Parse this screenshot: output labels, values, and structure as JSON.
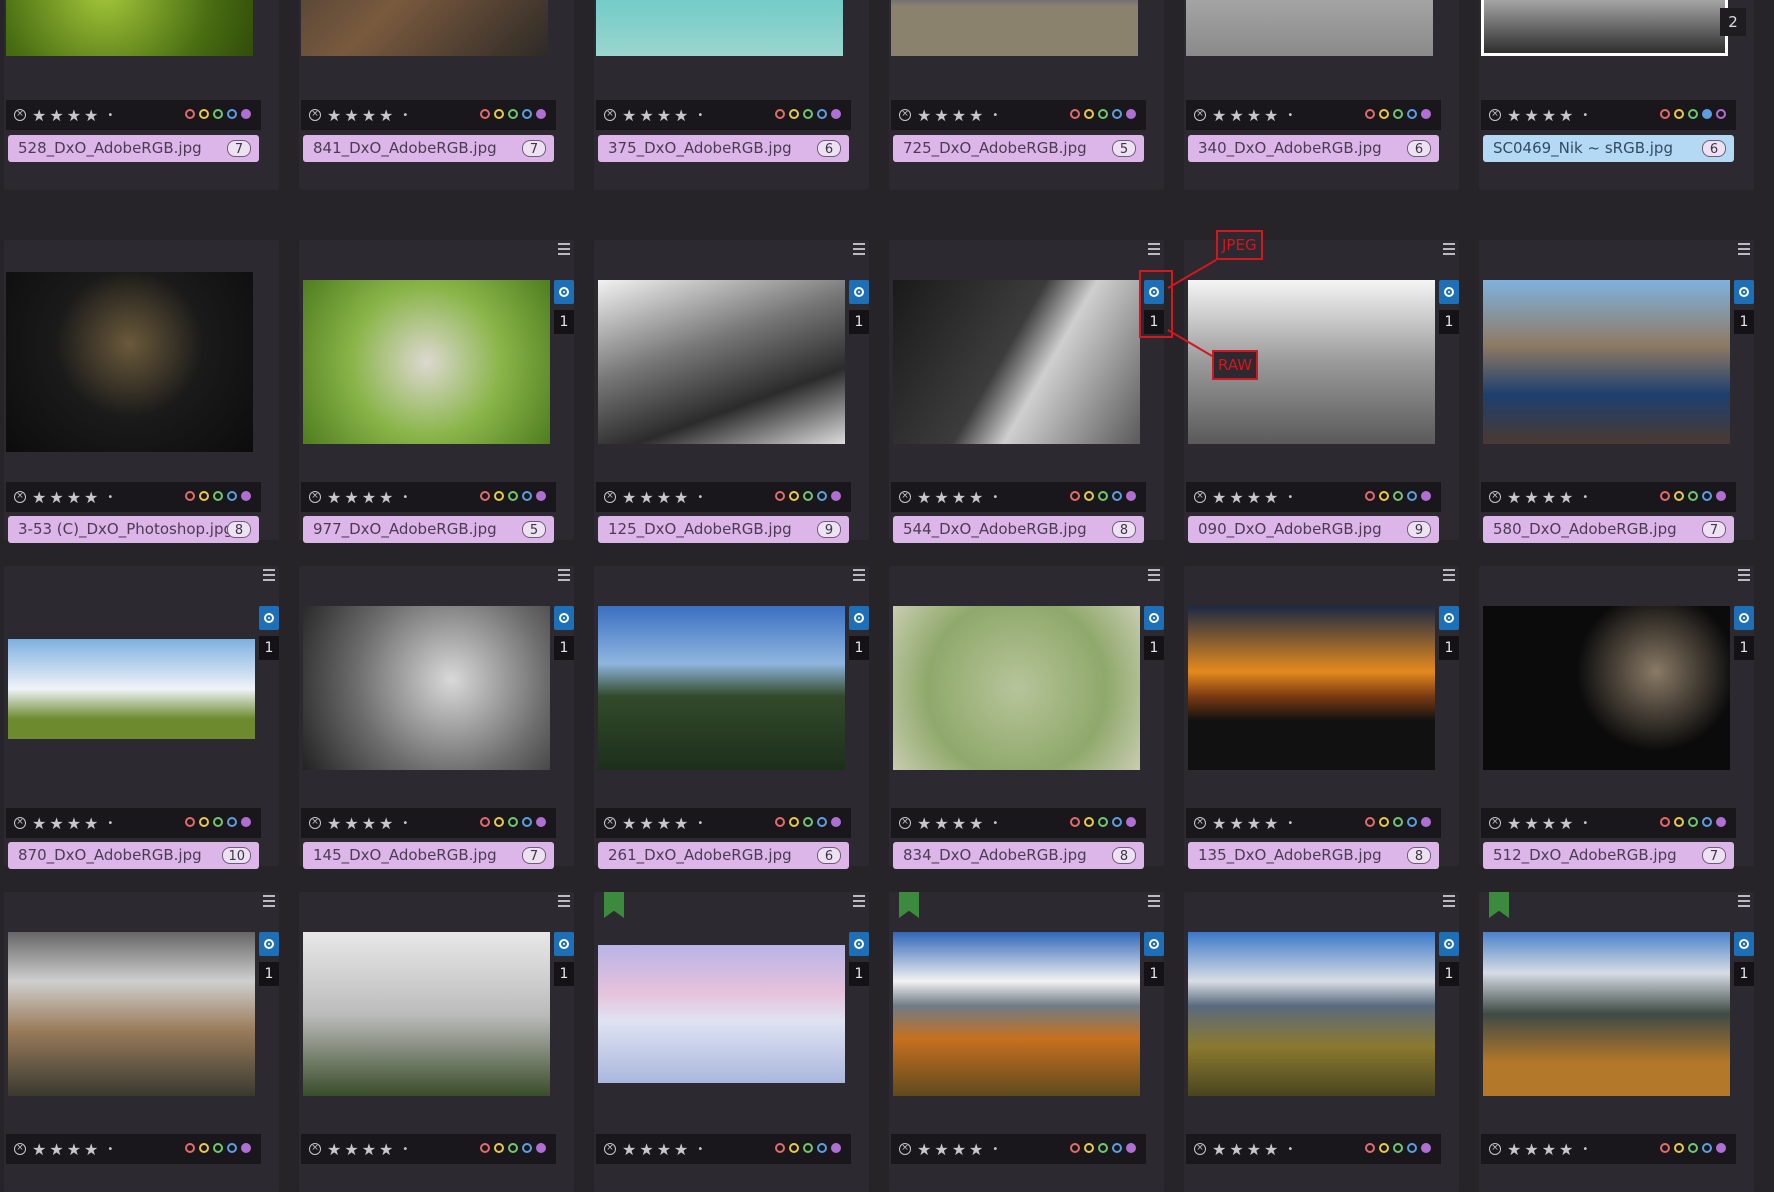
{
  "page_badge": "2",
  "rating": {
    "stars": "★★★★",
    "dot": "•",
    "reject_glyph": "×"
  },
  "color_labels": [
    "#e26a6a",
    "#e8c94a",
    "#6fc76f",
    "#5b9fe0",
    "#b06fd3"
  ],
  "sidecar": {
    "raw_count": "1"
  },
  "annotations": {
    "jpeg": "JPEG",
    "raw": "RAW"
  },
  "rows": [
    [
      {
        "file": "528_DxO_AdobeRGB.jpg",
        "count": "7"
      },
      {
        "file": "841_DxO_AdobeRGB.jpg",
        "count": "7"
      },
      {
        "file": "375_DxO_AdobeRGB.jpg",
        "count": "6"
      },
      {
        "file": "725_DxO_AdobeRGB.jpg",
        "count": "5"
      },
      {
        "file": "340_DxO_AdobeRGB.jpg",
        "count": "6"
      },
      {
        "file": "SC0469_Nik ~ sRGB.jpg",
        "count": "6"
      }
    ],
    [
      {
        "file": "3-53 (C)_DxO_Photoshop.jpg",
        "count": "8"
      },
      {
        "file": "977_DxO_AdobeRGB.jpg",
        "count": "5"
      },
      {
        "file": "125_DxO_AdobeRGB.jpg",
        "count": "9"
      },
      {
        "file": "544_DxO_AdobeRGB.jpg",
        "count": "8"
      },
      {
        "file": "090_DxO_AdobeRGB.jpg",
        "count": "9"
      },
      {
        "file": "580_DxO_AdobeRGB.jpg",
        "count": "7"
      }
    ],
    [
      {
        "file": "870_DxO_AdobeRGB.jpg",
        "count": "10"
      },
      {
        "file": "145_DxO_AdobeRGB.jpg",
        "count": "7"
      },
      {
        "file": "261_DxO_AdobeRGB.jpg",
        "count": "6"
      },
      {
        "file": "834_DxO_AdobeRGB.jpg",
        "count": "8"
      },
      {
        "file": "135_DxO_AdobeRGB.jpg",
        "count": "8"
      },
      {
        "file": "512_DxO_AdobeRGB.jpg",
        "count": "7"
      }
    ],
    [
      {},
      {},
      {},
      {},
      {},
      {}
    ]
  ]
}
